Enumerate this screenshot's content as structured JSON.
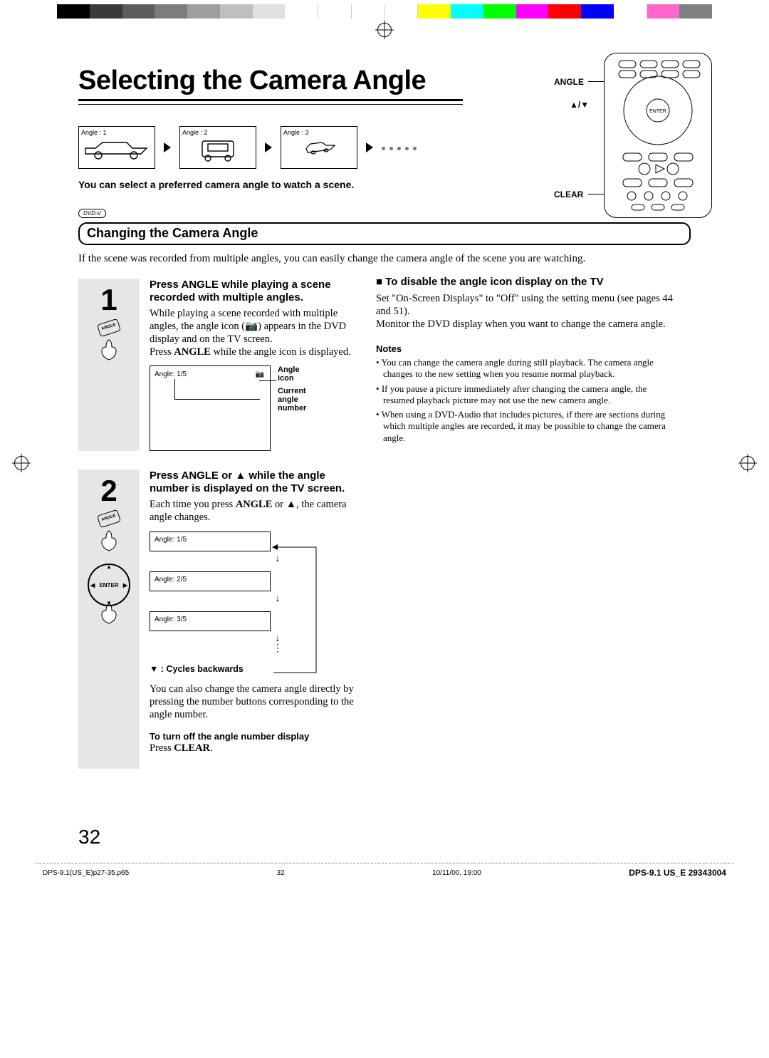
{
  "colorBar": [
    "#000000",
    "#3a3a3a",
    "#5c5c5c",
    "#7d7d7d",
    "#9e9e9e",
    "#bfbfbf",
    "#e0e0e0",
    "#ffffff",
    "#ffffff",
    "#ffffff",
    "#ffffff",
    "#ffff00",
    "#00ffff",
    "#00ff00",
    "#ff00ff",
    "#ff0000",
    "#0000ff",
    "#ffffff",
    "#ff66cc",
    "#808080"
  ],
  "title": "Selecting the Camera Angle",
  "angleIllus": {
    "box1": "Angle : 1",
    "box2": "Angle : 2",
    "box3": "Angle : 3"
  },
  "introLine": "You can select a preferred camera angle to watch a scene.",
  "dvdBadge": "DVD-V",
  "sectionHead": "Changing the Camera Angle",
  "sectionIntro": "If the scene was recorded from multiple angles, you can easily change the camera angle of the scene you are watching.",
  "remote": {
    "labelAngle": "ANGLE",
    "labelArrows": "▲/▼",
    "labelClear": "CLEAR"
  },
  "step1": {
    "num": "1",
    "btnLabel": "ANGLE",
    "head": "Press ANGLE while playing a scene recorded with multiple angles.",
    "text1": "While playing a scene recorded with multiple angles, the angle icon (📷) appears in the DVD display and on the TV screen.",
    "text2a": "Press ",
    "text2b": "ANGLE",
    "text2c": " while the angle icon is displayed.",
    "screenText": "Angle: 1/5",
    "callout1": "Angle icon",
    "callout2": "Current angle number"
  },
  "step2": {
    "num": "2",
    "btnLabel": "ANGLE",
    "enterLabel": "ENTER",
    "head": "Press ANGLE or ▲ while the angle number is displayed on the TV screen.",
    "text1a": "Each time you press ",
    "text1b": "ANGLE",
    "text1c": " or ▲, the camera angle changes.",
    "screens": [
      "Angle: 1/5",
      "Angle: 2/5",
      "Angle: 3/5"
    ],
    "cyclesNote": "▼ : Cycles backwards",
    "text2": "You can also change the camera angle directly by pressing the number buttons corresponding to the angle number.",
    "offHead": "To turn off the angle number display",
    "offTextA": "Press ",
    "offTextB": "CLEAR",
    "offTextC": "."
  },
  "rightCol": {
    "head": "■ To disable the angle icon display on the TV",
    "p1": "Set \"On-Screen Displays\" to \"Off\" using the setting menu (see pages 44 and 51).",
    "p2": "Monitor the DVD display when you want to change the camera angle.",
    "notesHead": "Notes",
    "notes": [
      "You can change the camera angle during still playback. The camera angle changes to the new setting when you resume normal playback.",
      "If you pause a picture immediately after changing the camera angle, the resumed playback picture may not use the new camera angle.",
      "When using a DVD-Audio that includes pictures, if there are sections during which multiple angles are recorded, it may be possible to change the camera angle."
    ]
  },
  "pageNum": "32",
  "footer": {
    "file": "DPS-9.1(US_E)p27-35.p65",
    "mid": "32",
    "date": "10/11/00, 19:00",
    "docid": "DPS-9.1 US_E   29343004"
  }
}
